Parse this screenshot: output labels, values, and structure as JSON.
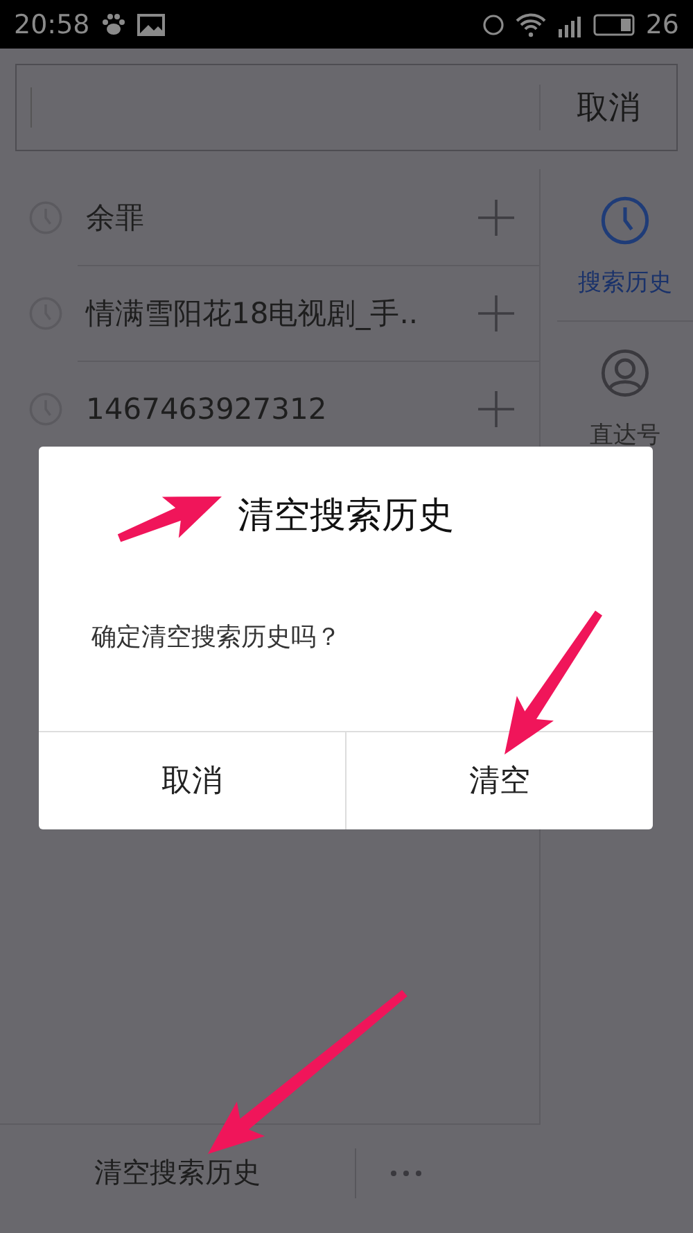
{
  "status_bar": {
    "time": "20:58",
    "battery": "26"
  },
  "search": {
    "cancel": "取消"
  },
  "history": [
    {
      "text": "余罪"
    },
    {
      "text": "情满雪阳花18电视剧_手.."
    },
    {
      "text": "1467463927312"
    }
  ],
  "sidebar": {
    "items": [
      {
        "label": "搜索历史",
        "kind": "clock",
        "selected": true
      },
      {
        "label": "直达号",
        "kind": "person",
        "selected": false
      }
    ]
  },
  "bottom_bar": {
    "clear": "清空搜索历史"
  },
  "dialog": {
    "title": "清空搜索历史",
    "message": "确定清空搜索历史吗？",
    "buttons": [
      "取消",
      "清空"
    ]
  }
}
